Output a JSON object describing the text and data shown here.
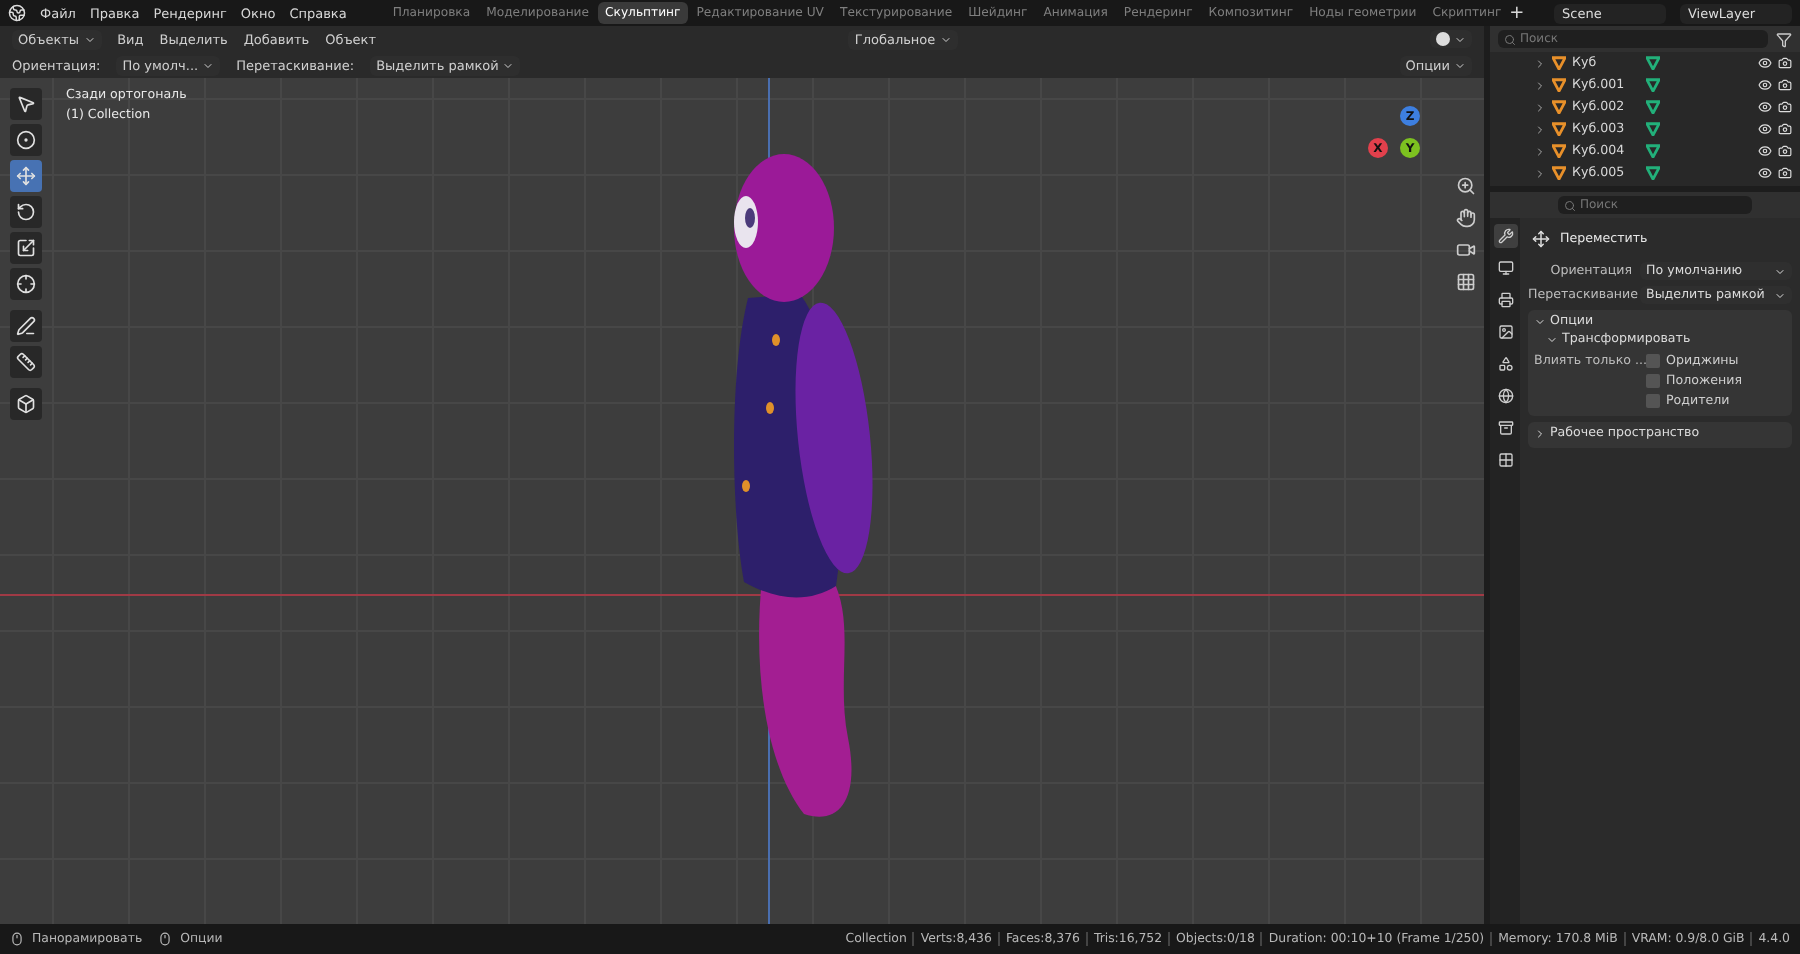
{
  "menu": [
    "Файл",
    "Правка",
    "Рендеринг",
    "Окно",
    "Справка"
  ],
  "workspaces": [
    {
      "label": "Планировка",
      "selected": false
    },
    {
      "label": "Моделирование",
      "selected": false
    },
    {
      "label": "Скульптинг",
      "selected": true
    },
    {
      "label": "Редактирование UV",
      "selected": false
    },
    {
      "label": "Текстурирование",
      "selected": false
    },
    {
      "label": "Шейдинг",
      "selected": false
    },
    {
      "label": "Анимация",
      "selected": false
    },
    {
      "label": "Рендеринг",
      "selected": false
    },
    {
      "label": "Композитинг",
      "selected": false
    },
    {
      "label": "Ноды геометрии",
      "selected": false
    },
    {
      "label": "Скриптинг",
      "selected": false
    }
  ],
  "add_workspace": "+",
  "scene": "Scene",
  "view_layer": "ViewLayer",
  "viewport_header": {
    "mode": "Объекты",
    "menus": [
      "Вид",
      "Выделить",
      "Добавить",
      "Объект"
    ],
    "orientation": "Глобальное"
  },
  "tool_settings": {
    "orientation_label": "Ориентация:",
    "orientation_value": "По умолч...",
    "drag_label": "Перетаскивание:",
    "drag_value": "Выделить рамкой",
    "options": "Опции"
  },
  "viewport": {
    "view_name": "Сзади ортогональ",
    "collection": "(1) Collection",
    "gizmo": [
      "X",
      "Y",
      "Z"
    ]
  },
  "tools": [
    {
      "kind": "select",
      "selected": false
    },
    {
      "kind": "cursor",
      "selected": false
    },
    {
      "kind": "move",
      "selected": true
    },
    {
      "kind": "rotate",
      "selected": false
    },
    {
      "kind": "scale",
      "selected": false
    },
    {
      "kind": "transform",
      "selected": false
    },
    {
      "kind": "annotate",
      "selected": false
    },
    {
      "kind": "measure",
      "selected": false
    },
    {
      "kind": "add_cube",
      "selected": false
    }
  ],
  "outliner": {
    "search_placeholder": "Поиск",
    "items": [
      "Куб",
      "Куб.001",
      "Куб.002",
      "Куб.003",
      "Куб.004",
      "Куб.005"
    ]
  },
  "properties": {
    "search_placeholder": "Поиск",
    "tabs": [
      {
        "kind": "tool",
        "selected": true
      },
      {
        "kind": "render",
        "selected": false
      },
      {
        "kind": "output",
        "selected": false
      },
      {
        "kind": "view_layer",
        "selected": false
      },
      {
        "kind": "scene",
        "selected": false
      },
      {
        "kind": "world",
        "selected": false
      },
      {
        "kind": "collection",
        "selected": false
      },
      {
        "kind": "texture",
        "selected": false
      }
    ],
    "tool_name": "Переместить",
    "fields": [
      {
        "label": "Ориентация",
        "value": "По умолчанию"
      },
      {
        "label": "Перетаскивание",
        "value": "Выделить рамкой"
      }
    ],
    "options_panel": {
      "title": "Опции",
      "expanded": true,
      "subpanel": {
        "title": "Трансформировать",
        "expanded": true
      },
      "affect_label": "Влиять только ...",
      "checkboxes": [
        {
          "label": "Ориджины",
          "checked": false
        },
        {
          "label": "Положения",
          "checked": false
        },
        {
          "label": "Родители",
          "checked": false
        }
      ]
    },
    "workspace_panel": {
      "title": "Рабочее пространство",
      "expanded": false
    }
  },
  "status_bar": {
    "hints": [
      "Панорамировать",
      "Опции"
    ],
    "stats": [
      "Collection",
      "Verts:8,436",
      "Faces:8,376",
      "Tris:16,752",
      "Objects:0/18",
      "Duration: 00:10+10 (Frame 1/250)",
      "Memory: 170.8 MiB",
      "VRAM: 0.9/8.0 GiB",
      "4.4.0"
    ]
  }
}
